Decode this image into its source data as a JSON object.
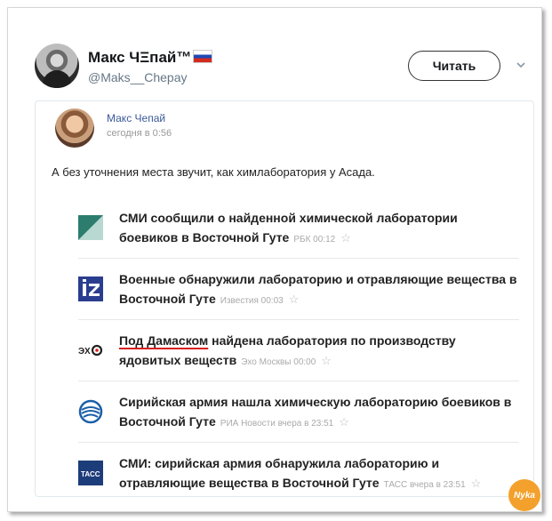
{
  "tweet": {
    "author_name": "Макс ЧΞпай™",
    "handle": "@Maks__Chepay",
    "follow_label": "Читать",
    "chevron_icon": "chevron-down-icon",
    "flag_icon": "russia-flag-icon"
  },
  "embed": {
    "name": "Макс Чепай",
    "time": "сегодня в 0:56",
    "text": "А без уточнения места звучит, как химлаборатория у Асада.",
    "news": [
      {
        "icon": "rbc-logo-icon",
        "title": "СМИ сообщили о найденной химической лаборатории боевиков в Восточной Гуте",
        "source": "РБК 00:12",
        "star": "☆"
      },
      {
        "icon": "izvestia-logo-icon",
        "title": "Военные обнаружили лабораторию и отравляющие вещества в Восточной Гуте",
        "source": "Известия 00:03",
        "star": "☆"
      },
      {
        "icon": "echo-moskvy-logo-icon",
        "title_underlined": "Под Дамаском",
        "title_rest": " найдена лаборатория по производству ядовитых веществ",
        "source": "Эхо Москвы 00:00",
        "star": "☆"
      },
      {
        "icon": "ria-novosti-logo-icon",
        "title": "Сирийская армия нашла химическую лабораторию боевиков в Восточной Гуте",
        "source": "РИА Новости вчера в 23:51",
        "star": "☆"
      },
      {
        "icon": "tass-logo-icon",
        "title": "СМИ: сирийская армия обнаружила лабораторию и отравляющие вещества в Восточной Гуте",
        "source": "ТАСС вчера в 23:51",
        "star": "☆",
        "logo_text": "ТАСС"
      }
    ]
  },
  "watermark_text": "Nyka",
  "colors": {
    "accent": "#d81e1e",
    "link": "#3b5998",
    "watermark": "#f3a12c"
  }
}
